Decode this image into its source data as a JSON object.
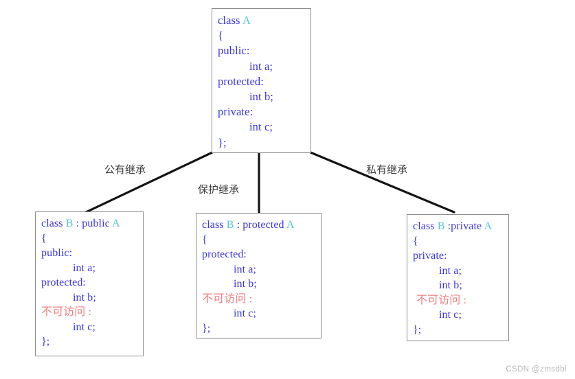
{
  "diagram": {
    "title": "C++ inheritance access-specifier diagram",
    "colors": {
      "keyword_blue": "#3a34e8",
      "class_cyan": "#54c6dc",
      "inaccessible_red": "#f07d7d",
      "box_border_gray": "#8a8a8a",
      "connector_black": "#141414",
      "label_gray": "#3c3c3c",
      "watermark_gray": "#b8b8b8",
      "background": "#ffffff"
    }
  },
  "base_class": {
    "name": "class-a-box",
    "lines": [
      {
        "kw": "class ",
        "cls": "A",
        "tail": ""
      },
      {
        "kw": "{",
        "cls": "",
        "tail": ""
      },
      {
        "kw": "public:",
        "cls": "",
        "tail": ""
      },
      {
        "indent": true,
        "kw": "int a;",
        "cls": "",
        "tail": ""
      },
      {
        "kw": "protected:",
        "cls": "",
        "tail": ""
      },
      {
        "indent": true,
        "kw": "int b;",
        "cls": "",
        "tail": ""
      },
      {
        "kw": "private:",
        "cls": "",
        "tail": ""
      },
      {
        "indent": true,
        "kw": "int c;",
        "cls": "",
        "tail": ""
      },
      {
        "kw": "};",
        "cls": "",
        "tail": ""
      }
    ],
    "text": {
      "l0_kw": "class ",
      "l0_cls": "A",
      "l1": "{",
      "l2": "public:",
      "l3": "int a;",
      "l4": "protected:",
      "l5": "int b;",
      "l6": "private:",
      "l7": "int c;",
      "l8": "};"
    }
  },
  "edges": [
    {
      "label": "公有继承",
      "meaning": "public inheritance",
      "from": "class A",
      "to": "class B : public A"
    },
    {
      "label": "保护继承",
      "meaning": "protected inheritance",
      "from": "class A",
      "to": "class B : protected A"
    },
    {
      "label": "私有继承",
      "meaning": "private inheritance",
      "from": "class A",
      "to": "class B :private A"
    }
  ],
  "edge_labels": {
    "public": "公有继承",
    "protected": "保护继承",
    "private": "私有继承"
  },
  "derived_public": {
    "name": "class-b-public-box",
    "text": {
      "l0_kw": "class ",
      "l0_cls": "B",
      "l0_mid": " : public ",
      "l0_cls2": "A",
      "l1": "{",
      "l2": "public:",
      "l3": "int a;",
      "l4": "protected:",
      "l5": "int b;",
      "l6": "不可访问 :",
      "l7": "int c;",
      "l8": "};"
    }
  },
  "derived_protected": {
    "name": "class-b-protected-box",
    "text": {
      "l0_kw": "class ",
      "l0_cls": "B",
      "l0_mid": " : protected ",
      "l0_cls2": "A",
      "l1": "{",
      "l2": "protected:",
      "l3": "int a;",
      "l4": "int b;",
      "l5": "不可访问 :",
      "l6": "int c;",
      "l7": "};"
    }
  },
  "derived_private": {
    "name": "class-b-private-box",
    "text": {
      "l0_kw": "class ",
      "l0_cls": "B",
      "l0_mid": " :private ",
      "l0_cls2": "A",
      "l1": "{",
      "l2": "private:",
      "l3": "int a;",
      "l4": "int b;",
      "l5": "不可访问 :",
      "l6": "int c;",
      "l7": "};"
    }
  },
  "watermark": {
    "text": "CSDN @zmsdbl"
  }
}
